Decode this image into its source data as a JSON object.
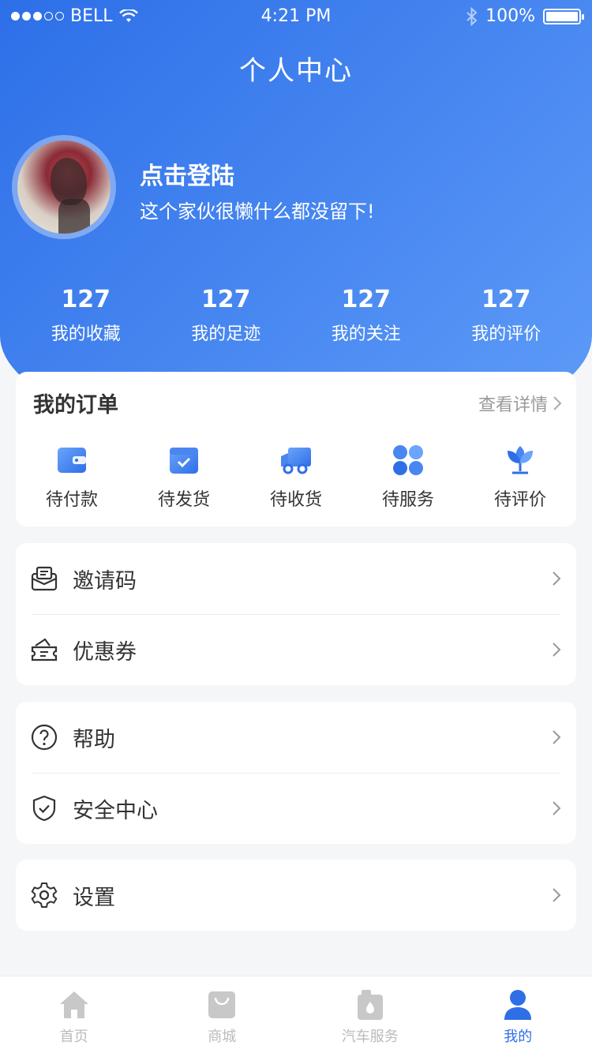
{
  "status_bar": {
    "carrier": "BELL",
    "time": "4:21 PM",
    "battery": "100%"
  },
  "header": {
    "title": "个人中心"
  },
  "profile": {
    "name": "点击登陆",
    "bio": "这个家伙很懒什么都没留下!"
  },
  "stats": [
    {
      "value": "127",
      "label": "我的收藏"
    },
    {
      "value": "127",
      "label": "我的足迹"
    },
    {
      "value": "127",
      "label": "我的关注"
    },
    {
      "value": "127",
      "label": "我的评价"
    }
  ],
  "orders": {
    "title": "我的订单",
    "more": "查看详情",
    "items": [
      {
        "label": "待付款",
        "icon": "wallet-icon"
      },
      {
        "label": "待发货",
        "icon": "package-icon"
      },
      {
        "label": "待收货",
        "icon": "truck-icon"
      },
      {
        "label": "待服务",
        "icon": "service-icon"
      },
      {
        "label": "待评价",
        "icon": "review-icon"
      }
    ]
  },
  "menu_groups": [
    [
      {
        "label": "邀请码",
        "icon": "invite-icon"
      },
      {
        "label": "优惠券",
        "icon": "coupon-icon"
      }
    ],
    [
      {
        "label": "帮助",
        "icon": "help-icon"
      },
      {
        "label": "安全中心",
        "icon": "shield-icon"
      }
    ],
    [
      {
        "label": "设置",
        "icon": "gear-icon"
      }
    ]
  ],
  "tabbar": [
    {
      "label": "首页",
      "icon": "home-icon",
      "active": false
    },
    {
      "label": "商城",
      "icon": "shopping-bag-icon",
      "active": false
    },
    {
      "label": "汽车服务",
      "icon": "car-service-icon",
      "active": false
    },
    {
      "label": "我的",
      "icon": "user-icon",
      "active": true
    }
  ],
  "colors": {
    "primary": "#2f6fe6",
    "gradient_start": "#2d6fe8",
    "gradient_end": "#5f9cf8",
    "inactive": "#bbbbbb"
  }
}
